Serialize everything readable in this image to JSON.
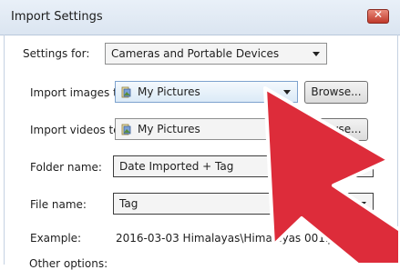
{
  "window": {
    "title": "Import Settings"
  },
  "settings_for": {
    "label": "Settings for:",
    "value": "Cameras and Portable Devices"
  },
  "import_images": {
    "label": "Import images to:",
    "value": "My Pictures",
    "browse_label": "Browse..."
  },
  "import_videos": {
    "label": "Import videos to:",
    "value": "My Pictures",
    "browse_label": "Browse..."
  },
  "folder_name": {
    "label": "Folder name:",
    "value": "Date Imported + Tag"
  },
  "file_name": {
    "label": "File name:",
    "value": "Tag"
  },
  "example": {
    "label": "Example:",
    "value": "2016-03-03 Himalayas\\Himalayas 001.JPG"
  },
  "other_options": {
    "label": "Other options:"
  },
  "colors": {
    "cursor": "#dd2c3a",
    "close": "#c0392b",
    "titlebar": "#dbe5f1"
  },
  "icons": {
    "folder": "folder-icon",
    "close": "close-icon",
    "dropdown": "chevron-down-icon"
  }
}
